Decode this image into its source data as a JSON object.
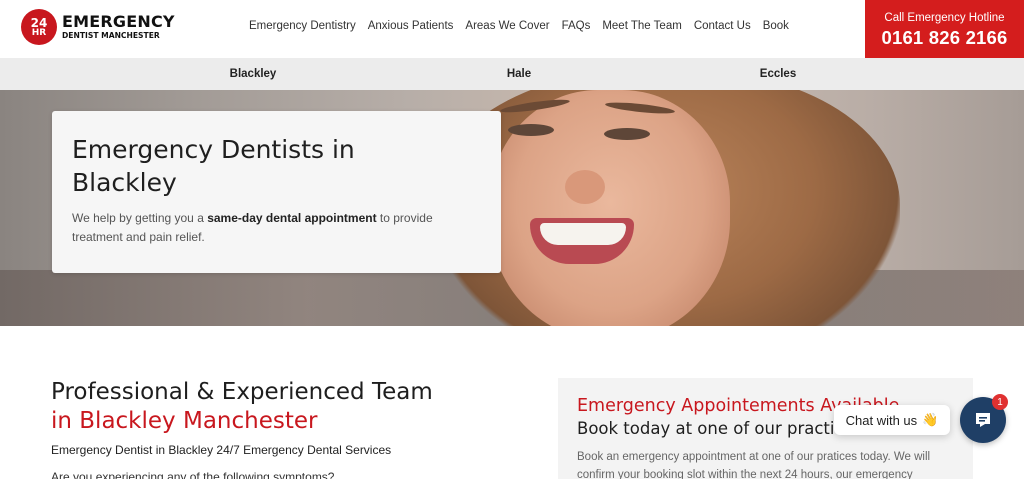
{
  "header": {
    "logo": {
      "badge_line1": "24",
      "badge_line2": "HR",
      "name": "EMERGENCY",
      "tagline": "DENTIST MANCHESTER"
    },
    "nav": [
      "Emergency Dentistry",
      "Anxious Patients",
      "Areas We Cover",
      "FAQs",
      "Meet The Team",
      "Contact Us",
      "Book"
    ],
    "hotline": {
      "label": "Call Emergency Hotline",
      "number": "0161 826 2166"
    }
  },
  "subnav": [
    "Blackley",
    "Hale",
    "Eccles"
  ],
  "hero": {
    "title": "Emergency Dentists in Blackley",
    "text_before": "We help by getting you a ",
    "text_bold": "same-day dental appointment",
    "text_after": " to provide treatment and pain relief."
  },
  "team": {
    "heading": "Professional & Experienced Team",
    "heading_red": "in Blackley Manchester",
    "subtitle": "Emergency Dentist in Blackley 24/7 Emergency Dental Services",
    "question": "Are you experiencing any of the following symptoms?"
  },
  "booking": {
    "title": "Emergency Appointements Available",
    "subtitle": "Book today at one of our practices",
    "text": "Book an emergency appointment at one of our pratices today. We will confirm your booking slot within the next 24 hours, our emergency"
  },
  "chat": {
    "bubble_text": "Chat with us",
    "bubble_emoji": "👋",
    "badge_count": "1"
  },
  "colors": {
    "brand_red": "#d41d1d",
    "chat_navy": "#1f3f66"
  }
}
